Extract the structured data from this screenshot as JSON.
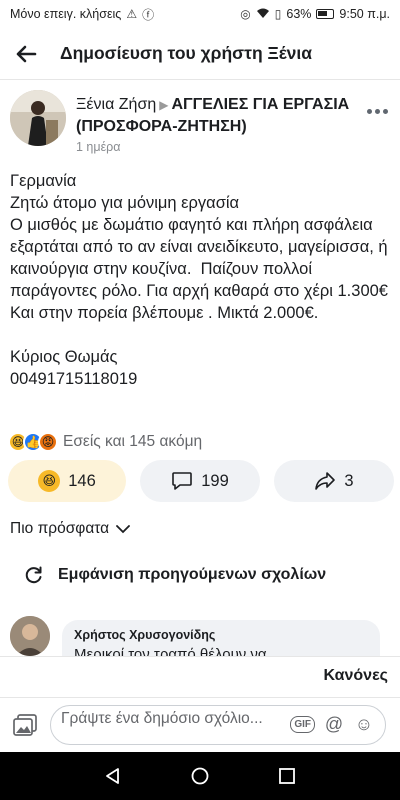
{
  "status_bar": {
    "carrier": "Μόνο επειγ. κλήσεις",
    "battery": "63%",
    "time": "9:50 π.μ."
  },
  "app_bar": {
    "title": "Δημοσίευση του χρήστη Ξένια"
  },
  "post": {
    "author": "Ξένια Ζήση",
    "group": "ΑΓΓΕΛΙΕΣ ΓΙΑ ΕΡΓΑΣΙΑ (ΠΡΟΣΦΟΡΑ-ΖΗΤΗΣΗ)",
    "time": "1 ημέρα",
    "body": "Γερμανία\nΖητώ άτομο για μόνιμη εργασία\nΟ μισθός με δωμάτιο φαγητό και πλήρη ασφάλεια εξαρτάται από το αν είναι ανειδίκευτο, μαγείρισσα, ή καινούργια στην κουζίνα.  Παίζουν πολλοί παράγοντες ρόλο. Για αρχή καθαρά στο χέρι 1.300€\nΚαι στην πορεία βλέπουμε . Μικτά 2.000€.\n\nΚύριος Θωμάς\n00491715118019",
    "reactions_text": "Εσείς και 145 ακόμη",
    "reaction_count": "146",
    "comment_count": "199",
    "share_count": "3"
  },
  "comments_section": {
    "sort_label": "Πιο πρόσφατα",
    "previous_label": "Εμφάνιση προηγούμενων σχολίων",
    "first_comment": {
      "author": "Χρήστος Χρυσογονίδης",
      "text": "Μερικοί τον τραπό θέλουν να"
    },
    "rules_label": "Κανόνες",
    "composer_placeholder": "Γράψτε ένα δημόσιο σχόλιο...",
    "gif_label": "GIF"
  }
}
